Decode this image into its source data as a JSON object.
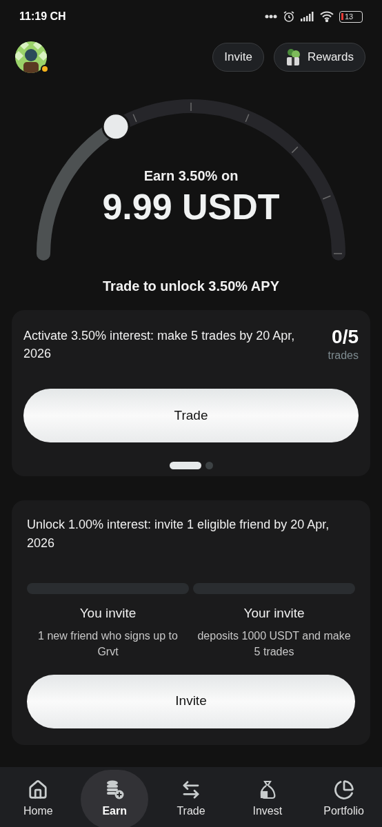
{
  "status_bar": {
    "time": "11:19 CH",
    "battery": "13"
  },
  "header": {
    "avatar": {
      "online": true
    },
    "buttons": [
      {
        "label": "Invite",
        "kind": "text"
      },
      {
        "label": "Rewards",
        "kind": "icon"
      }
    ]
  },
  "gauge": {
    "caption": "Earn 3.50% on",
    "amount": "9.99 USDT"
  },
  "unlock_title": "Trade to unlock 3.50% APY",
  "trade_card": {
    "text": "Activate 3.50% interest: make 5 trades by 20 Apr, 2026",
    "count": "0/5",
    "count_label": "trades",
    "button": "Trade",
    "dots": [
      {
        "selected": true
      },
      {
        "selected": false
      }
    ]
  },
  "invite_card": {
    "text": "Unlock 1.00% interest: invite 1 eligible friend by 20 Apr, 2026",
    "steps": [
      {
        "title": "You invite",
        "desc": "1 new friend who signs up to Grvt"
      },
      {
        "title": "Your invite",
        "desc": "deposits 1000 USDT and make 5 trades"
      }
    ],
    "button": "Invite"
  },
  "nav": [
    {
      "label": "Home",
      "selected": false
    },
    {
      "label": "Earn",
      "selected": true
    },
    {
      "label": "Trade",
      "selected": false
    },
    {
      "label": "Invest",
      "selected": false
    },
    {
      "label": "Portfolio",
      "selected": false
    }
  ]
}
